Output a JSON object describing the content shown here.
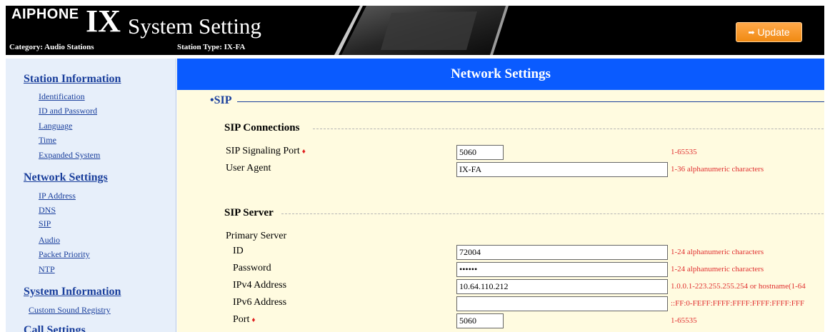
{
  "header": {
    "brand": "AIPHONE",
    "ix": "IX",
    "title": "System Setting",
    "category": "Category: Audio Stations",
    "station_type": "Station Type: IX-FA",
    "update_label": "Update",
    "update_icon": "arrow-right-icon"
  },
  "sidebar": {
    "station_information": {
      "label": "Station Information",
      "items": [
        "Identification",
        "ID and Password",
        "Language",
        "Time",
        "Expanded System"
      ]
    },
    "network_settings": {
      "label": "Network Settings",
      "items": [
        "IP Address",
        "DNS",
        "SIP",
        "Audio",
        "Packet Priority",
        "NTP"
      ]
    },
    "system_information": {
      "label": "System Information",
      "items": [
        "Custom Sound Registry"
      ]
    },
    "call_settings": {
      "label": "Call Settings"
    }
  },
  "main": {
    "banner": "Network Settings",
    "section": "•SIP",
    "sip_connections": {
      "title": "SIP Connections",
      "signaling_port": {
        "label": "SIP Signaling Port",
        "value": "5060",
        "hint": "1-65535"
      },
      "user_agent": {
        "label": "User Agent",
        "value": "IX-FA",
        "hint": "1-36 alphanumeric characters"
      }
    },
    "sip_server": {
      "title": "SIP Server",
      "primary_label": "Primary Server",
      "id": {
        "label": "ID",
        "value": "72004",
        "hint": "1-24 alphanumeric characters"
      },
      "password": {
        "label": "Password",
        "value": "••••••",
        "hint": "1-24 alphanumeric characters"
      },
      "ipv4": {
        "label": "IPv4 Address",
        "value": "10.64.110.212",
        "hint": "1.0.0.1-223.255.255.254 or hostname(1-64"
      },
      "ipv6": {
        "label": "IPv6 Address",
        "value": "",
        "hint": "::FF:0-FEFF:FFFF:FFFF:FFFF:FFFF:FFF"
      },
      "port": {
        "label": "Port",
        "value": "5060",
        "hint": "1-65535"
      }
    },
    "required_marker": "♦"
  },
  "colors": {
    "banner": "#0a5bff",
    "sidebar_bg": "#e7effa",
    "main_bg": "#fffbe0",
    "link": "#1a3f9c",
    "hint": "#e03030",
    "update_button": "#f08a12"
  }
}
